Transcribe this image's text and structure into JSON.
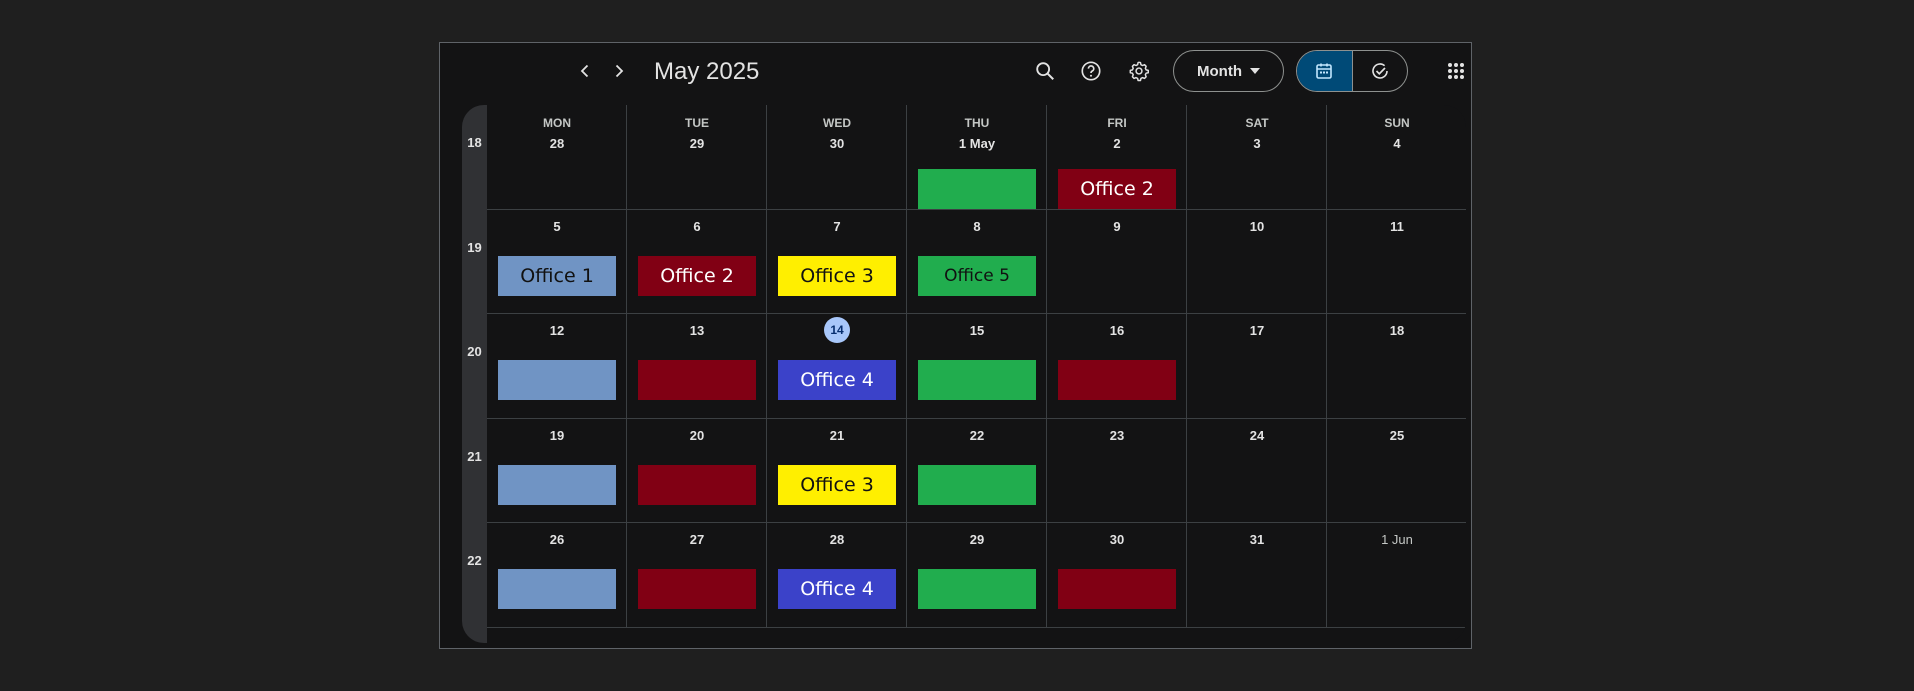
{
  "header": {
    "title": "May 2025",
    "view_label": "Month"
  },
  "colors": {
    "office1": "#7094c4",
    "office2": "#810014",
    "office3": "#ffef00",
    "office4": "#3b42c9",
    "office5": "#21ad4e",
    "today": "#a8c7fa"
  },
  "weekdays": [
    "MON",
    "TUE",
    "WED",
    "THU",
    "FRI",
    "SAT",
    "SUN"
  ],
  "weeks": [
    {
      "num": "18",
      "days": [
        "28",
        "29",
        "30",
        "1 May",
        "2",
        "3",
        "4"
      ]
    },
    {
      "num": "19",
      "days": [
        "5",
        "6",
        "7",
        "8",
        "9",
        "10",
        "11"
      ]
    },
    {
      "num": "20",
      "days": [
        "12",
        "13",
        "14",
        "15",
        "16",
        "17",
        "18"
      ]
    },
    {
      "num": "21",
      "days": [
        "19",
        "20",
        "21",
        "22",
        "23",
        "24",
        "25"
      ]
    },
    {
      "num": "22",
      "days": [
        "26",
        "27",
        "28",
        "29",
        "30",
        "31",
        "1 Jun"
      ]
    }
  ],
  "today": {
    "week": 2,
    "day": 2
  },
  "events": [
    {
      "week": 0,
      "day": 3,
      "label": "",
      "office": "office5"
    },
    {
      "week": 0,
      "day": 4,
      "label": "Office 2",
      "office": "office2"
    },
    {
      "week": 1,
      "day": 0,
      "label": "Office 1",
      "office": "office1"
    },
    {
      "week": 1,
      "day": 1,
      "label": "Office 2",
      "office": "office2"
    },
    {
      "week": 1,
      "day": 2,
      "label": "Office 3",
      "office": "office3"
    },
    {
      "week": 1,
      "day": 3,
      "label": "Office 5",
      "office": "office5"
    },
    {
      "week": 2,
      "day": 0,
      "label": "",
      "office": "office1"
    },
    {
      "week": 2,
      "day": 1,
      "label": "",
      "office": "office2"
    },
    {
      "week": 2,
      "day": 2,
      "label": "Office 4",
      "office": "office4"
    },
    {
      "week": 2,
      "day": 3,
      "label": "",
      "office": "office5"
    },
    {
      "week": 2,
      "day": 4,
      "label": "",
      "office": "office2"
    },
    {
      "week": 3,
      "day": 0,
      "label": "",
      "office": "office1"
    },
    {
      "week": 3,
      "day": 1,
      "label": "",
      "office": "office2"
    },
    {
      "week": 3,
      "day": 2,
      "label": "Office 3",
      "office": "office3"
    },
    {
      "week": 3,
      "day": 3,
      "label": "",
      "office": "office5"
    },
    {
      "week": 4,
      "day": 0,
      "label": "",
      "office": "office1"
    },
    {
      "week": 4,
      "day": 1,
      "label": "",
      "office": "office2"
    },
    {
      "week": 4,
      "day": 2,
      "label": "Office 4",
      "office": "office4"
    },
    {
      "week": 4,
      "day": 3,
      "label": "",
      "office": "office5"
    },
    {
      "week": 4,
      "day": 4,
      "label": "",
      "office": "office2"
    }
  ]
}
